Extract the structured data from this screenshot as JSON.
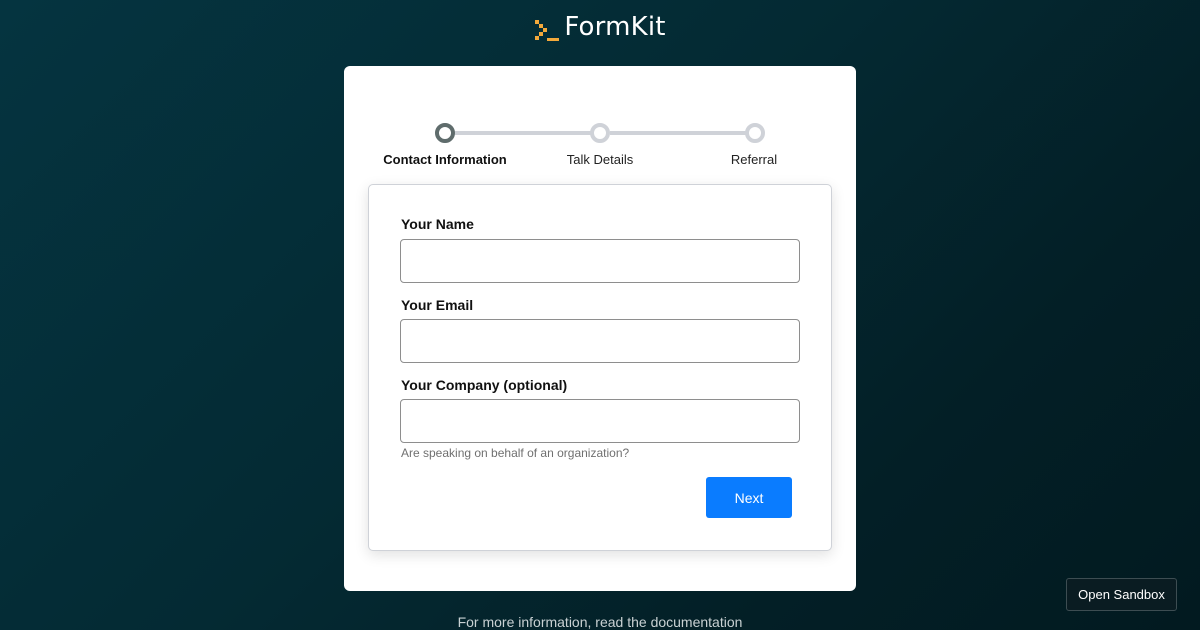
{
  "header": {
    "logo_text": "FormKit",
    "logo_icon": "formkit-logo-icon",
    "accent_color": "#f3a93b"
  },
  "steps": [
    {
      "label": "Contact Information",
      "active": true
    },
    {
      "label": "Talk Details",
      "active": false
    },
    {
      "label": "Referral",
      "active": false
    }
  ],
  "form": {
    "name_label": "Your Name",
    "name_value": "",
    "email_label": "Your Email",
    "email_value": "",
    "company_label": "Your Company (optional)",
    "company_value": "",
    "company_help": "Are speaking on behalf of an organization?",
    "next_label": "Next"
  },
  "footer": {
    "prefix": "For more information, read the ",
    "link_text": "documentation"
  },
  "sandbox_label": "Open Sandbox",
  "colors": {
    "primary_button": "#0a7cff",
    "active_step": "#5f6c6c",
    "inactive_step": "#cfd2d8"
  }
}
